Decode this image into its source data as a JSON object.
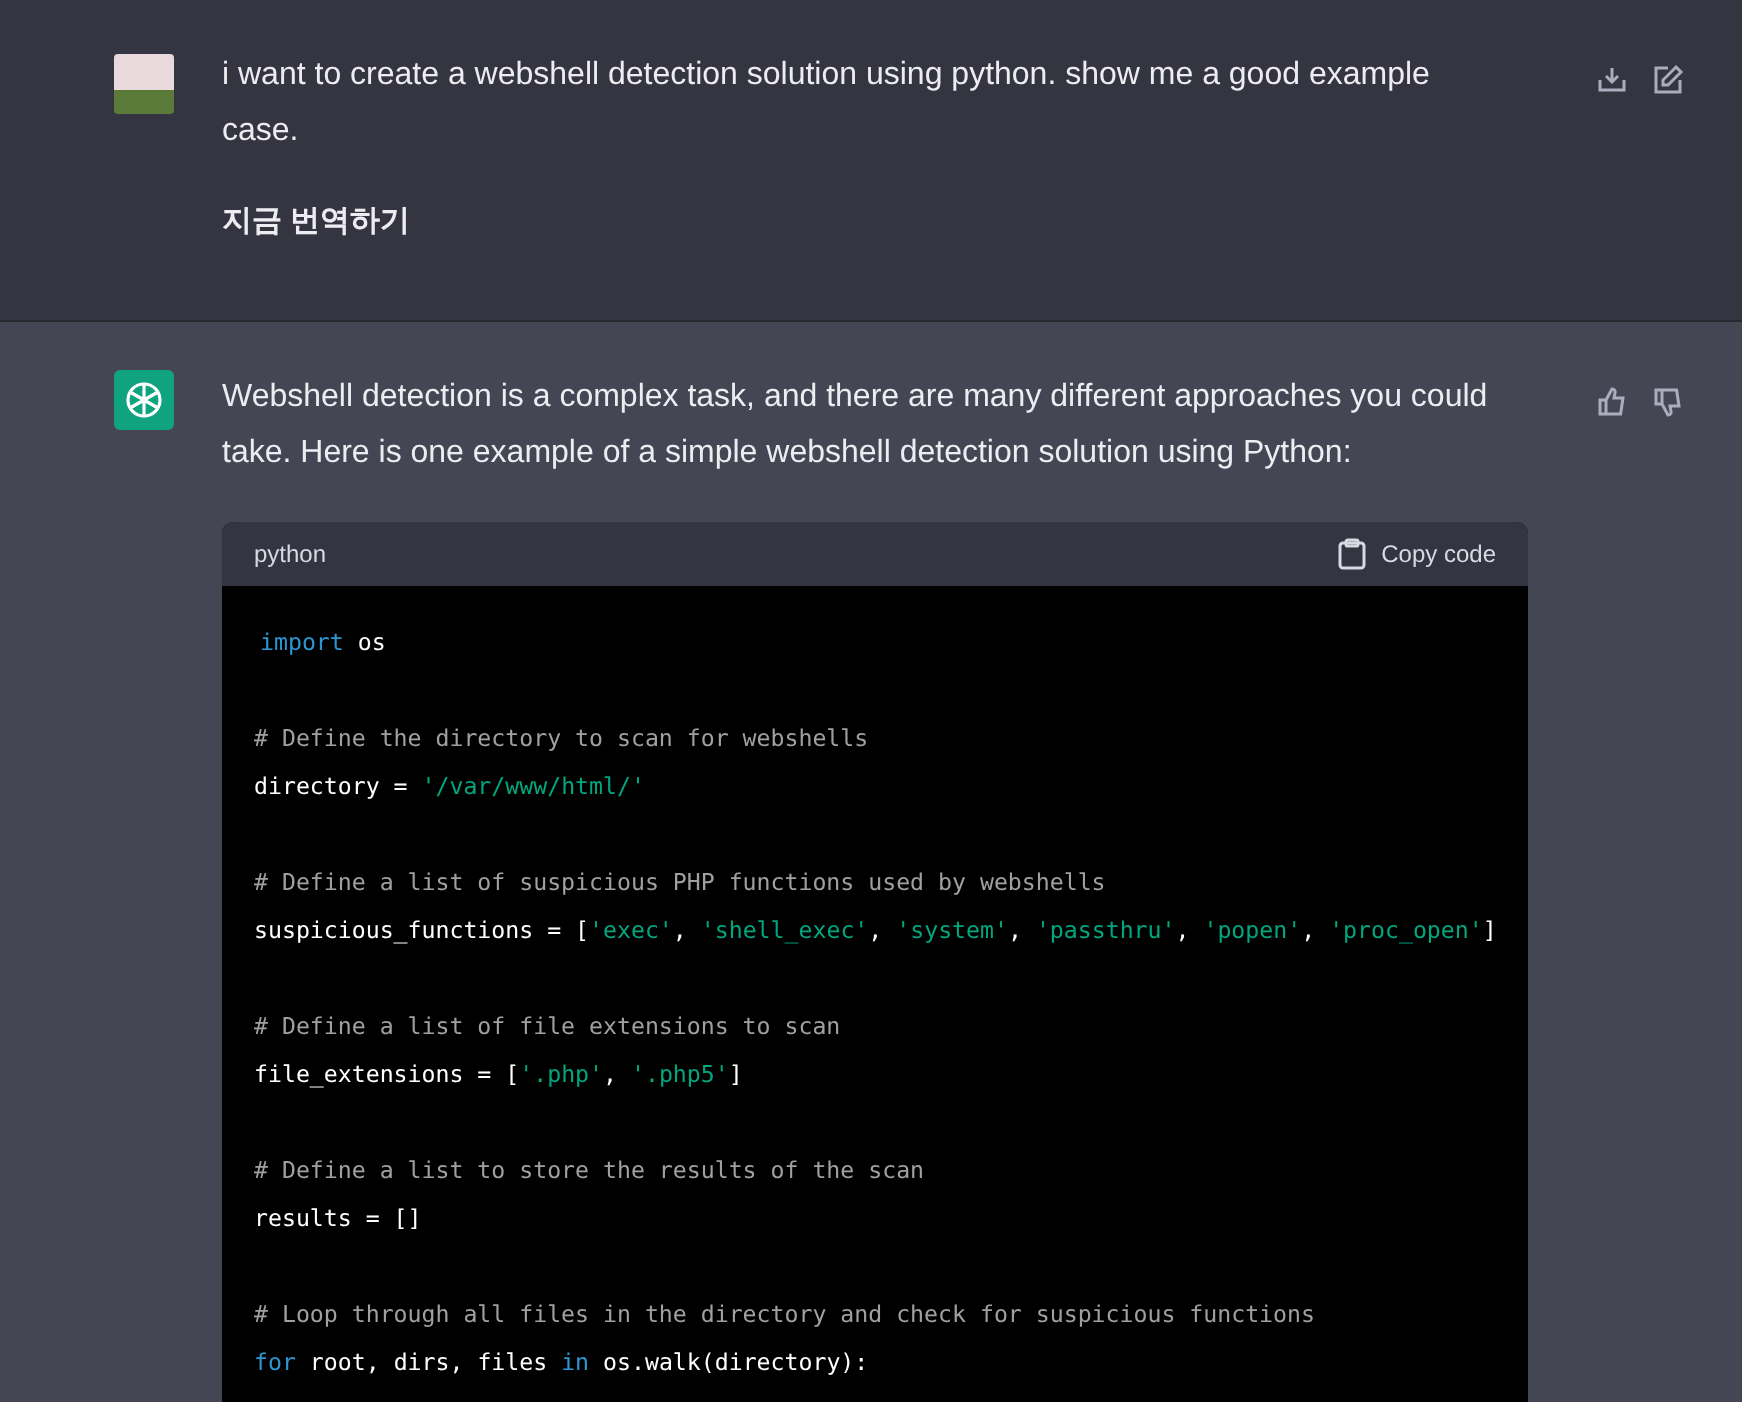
{
  "user_message": {
    "text": "i want to create a webshell detection solution using python. show me a good example case.",
    "translate_link": "지금 번역하기"
  },
  "assistant_message": {
    "text": "Webshell detection is a complex task, and there are many different approaches you could take. Here is one example of a simple webshell detection solution using Python:",
    "code_block": {
      "language": "python",
      "copy_label": "Copy code",
      "lines": [
        {
          "kind": "code",
          "tokens": [
            {
              "kind": "keyword",
              "text": "import"
            },
            {
              "kind": "plain",
              "text": " os"
            }
          ]
        },
        {
          "kind": "blank"
        },
        {
          "kind": "code",
          "tokens": [
            {
              "kind": "comment",
              "text": "# Define the directory to scan for webshells"
            }
          ]
        },
        {
          "kind": "code",
          "tokens": [
            {
              "kind": "plain",
              "text": "directory = "
            },
            {
              "kind": "string",
              "text": "'/var/www/html/'"
            }
          ]
        },
        {
          "kind": "blank"
        },
        {
          "kind": "code",
          "tokens": [
            {
              "kind": "comment",
              "text": "# Define a list of suspicious PHP functions used by webshells"
            }
          ]
        },
        {
          "kind": "code",
          "tokens": [
            {
              "kind": "plain",
              "text": "suspicious_functions = ["
            },
            {
              "kind": "string",
              "text": "'exec'"
            },
            {
              "kind": "plain",
              "text": ", "
            },
            {
              "kind": "string",
              "text": "'shell_exec'"
            },
            {
              "kind": "plain",
              "text": ", "
            },
            {
              "kind": "string",
              "text": "'system'"
            },
            {
              "kind": "plain",
              "text": ", "
            },
            {
              "kind": "string",
              "text": "'passthru'"
            },
            {
              "kind": "plain",
              "text": ", "
            },
            {
              "kind": "string",
              "text": "'popen'"
            },
            {
              "kind": "plain",
              "text": ", "
            },
            {
              "kind": "string",
              "text": "'proc_open'"
            },
            {
              "kind": "plain",
              "text": "]"
            }
          ]
        },
        {
          "kind": "blank"
        },
        {
          "kind": "code",
          "tokens": [
            {
              "kind": "comment",
              "text": "# Define a list of file extensions to scan"
            }
          ]
        },
        {
          "kind": "code",
          "tokens": [
            {
              "kind": "plain",
              "text": "file_extensions = ["
            },
            {
              "kind": "string",
              "text": "'.php'"
            },
            {
              "kind": "plain",
              "text": ", "
            },
            {
              "kind": "string",
              "text": "'.php5'"
            },
            {
              "kind": "plain",
              "text": "]"
            }
          ]
        },
        {
          "kind": "blank"
        },
        {
          "kind": "code",
          "tokens": [
            {
              "kind": "comment",
              "text": "# Define a list to store the results of the scan"
            }
          ]
        },
        {
          "kind": "code",
          "tokens": [
            {
              "kind": "plain",
              "text": "results = []"
            }
          ]
        },
        {
          "kind": "blank"
        },
        {
          "kind": "code",
          "tokens": [
            {
              "kind": "comment",
              "text": "# Loop through all files in the directory and check for suspicious functions"
            }
          ]
        },
        {
          "kind": "code",
          "tokens": [
            {
              "kind": "keyword",
              "text": "for"
            },
            {
              "kind": "plain",
              "text": " root, dirs, files "
            },
            {
              "kind": "keyword",
              "text": "in"
            },
            {
              "kind": "plain",
              "text": " os.walk(directory):"
            }
          ]
        }
      ]
    }
  }
}
